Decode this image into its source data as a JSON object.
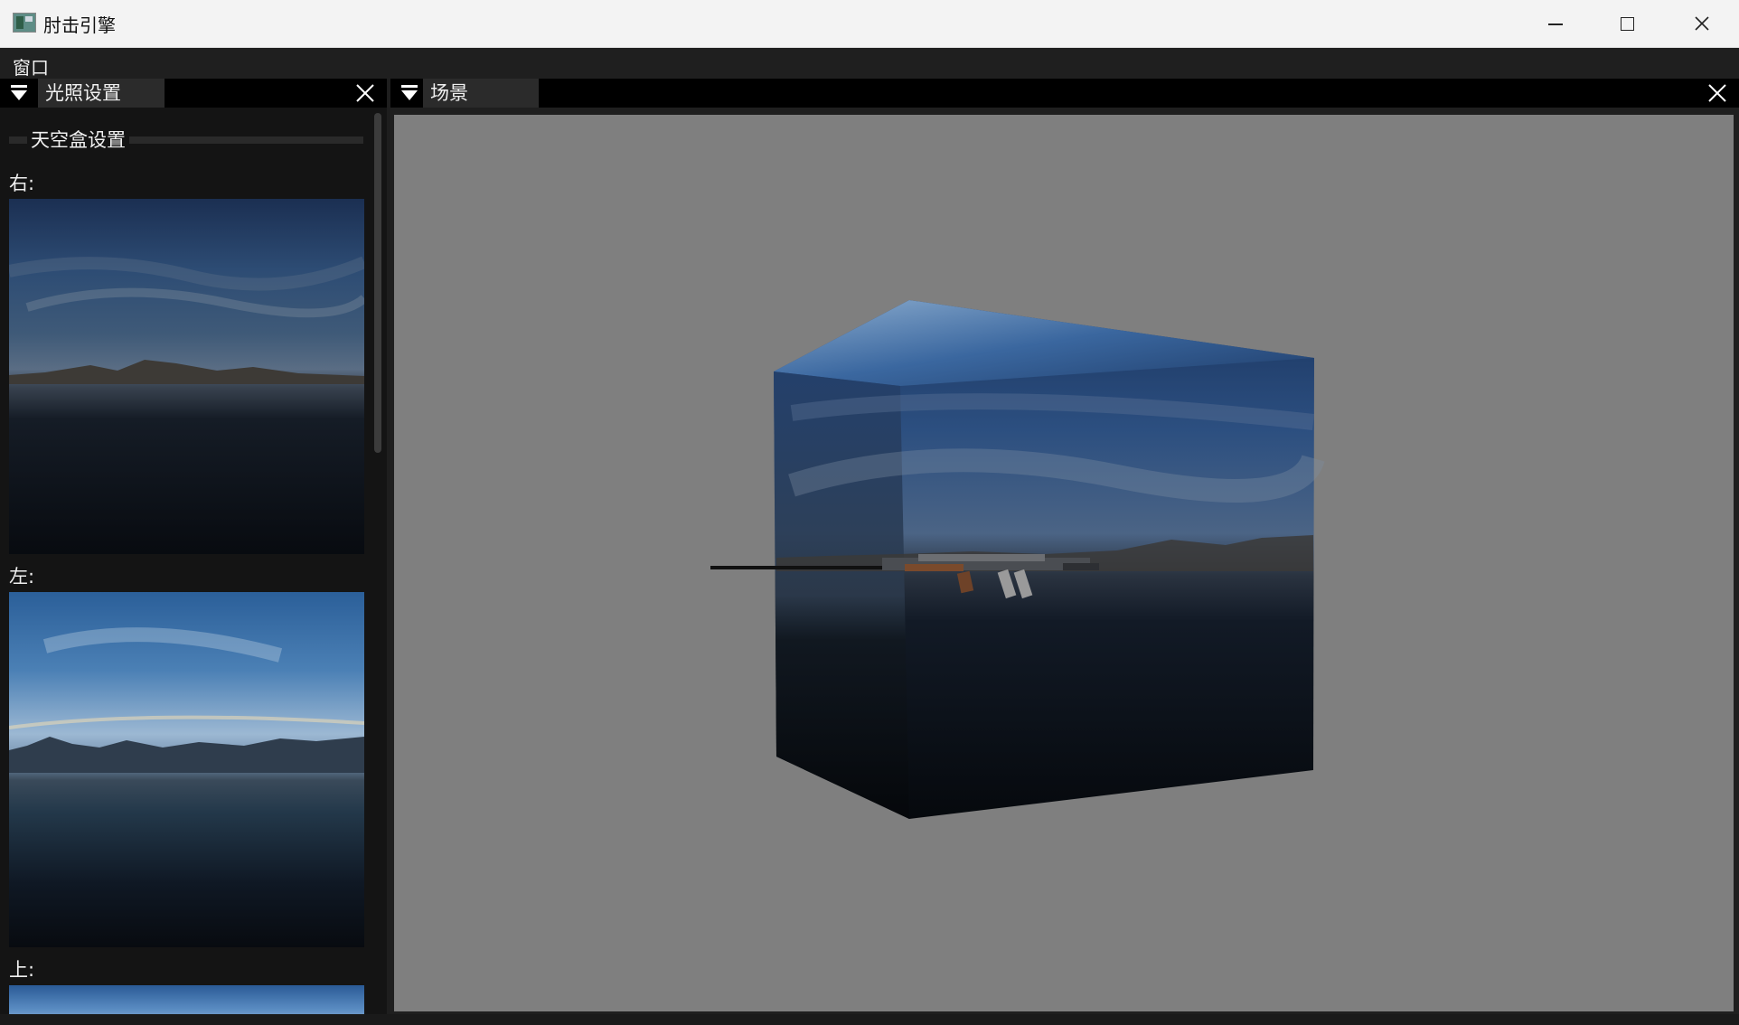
{
  "window": {
    "title": "肘击引擎",
    "controls": {
      "minimize": "minimize-icon",
      "maximize": "maximize-icon",
      "close": "close-icon"
    }
  },
  "menubar": {
    "items": [
      "窗口"
    ]
  },
  "lighting_panel": {
    "tab_label": "光照设置",
    "section_title": "天空盒设置",
    "faces": [
      {
        "label": "右:",
        "image": "skybox-right-face"
      },
      {
        "label": "左:",
        "image": "skybox-left-face"
      },
      {
        "label": "上:",
        "image": "skybox-top-face"
      }
    ]
  },
  "scene_panel": {
    "tab_label": "场景",
    "viewport_background": "#7f7f7f",
    "objects": [
      "skybox-cube",
      "rifle-model"
    ]
  },
  "colors": {
    "titlebar_bg": "#f3f3f3",
    "menubar_bg": "#1f1f1f",
    "tab_bg": "#2b2b2b",
    "panel_bg": "#141414",
    "text_light": "#f0f0f0"
  }
}
